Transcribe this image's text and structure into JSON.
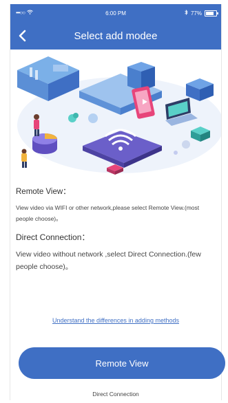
{
  "status_bar": {
    "carrier": "•••○○",
    "time": "6:00 PM",
    "battery_percent": "77%"
  },
  "nav": {
    "title": "Select add modee"
  },
  "content": {
    "remote_title": "Remote View：",
    "remote_desc": "View video via WIFI or other network,please select Remote View.(most people choose)。",
    "direct_title": "Direct Connection：",
    "direct_desc": "View video without network ,select Direct Connection.(few people choose)。"
  },
  "actions": {
    "differences_link": "Understand the differences in adding methods",
    "primary_button": "Remote View",
    "secondary_button": "Direct Connection"
  },
  "colors": {
    "brand_blue": "#3f6fc4"
  },
  "icons": {
    "back": "chevron-left-icon",
    "wifi": "wifi-icon",
    "battery": "battery-icon",
    "bluetooth": "bluetooth-icon"
  }
}
